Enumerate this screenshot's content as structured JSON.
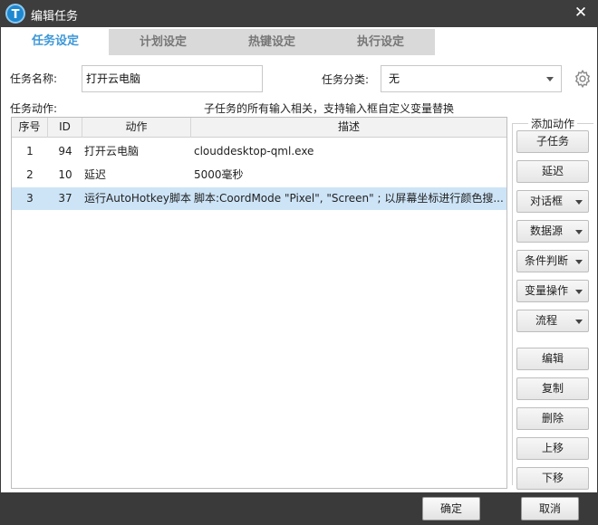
{
  "window": {
    "title": "编辑任务",
    "app_icon_letter": "T",
    "close_symbol": "✕"
  },
  "tabs": [
    {
      "label": "任务设定",
      "active": true
    },
    {
      "label": "计划设定",
      "active": false
    },
    {
      "label": "热键设定",
      "active": false
    },
    {
      "label": "执行设定",
      "active": false
    }
  ],
  "form": {
    "name_label": "任务名称:",
    "name_value": "打开云电脑",
    "category_label": "任务分类:",
    "category_value": "无",
    "actions_label": "任务动作:",
    "hint": "子任务的所有输入相关，支持输入框自定义变量替换"
  },
  "table": {
    "columns": [
      "序号",
      "ID",
      "动作",
      "描述"
    ],
    "rows": [
      {
        "seq": "1",
        "id": "94",
        "action": "打开云电脑",
        "desc": "clouddesktop-qml.exe",
        "selected": false
      },
      {
        "seq": "2",
        "id": "10",
        "action": "延迟",
        "desc": "5000毫秒",
        "selected": false
      },
      {
        "seq": "3",
        "id": "37",
        "action": "运行AutoHotkey脚本",
        "desc": "脚本:CoordMode \"Pixel\", \"Screen\" ; 以屏幕坐标进行颜色搜...",
        "selected": true
      }
    ]
  },
  "add_actions": {
    "title": "添加动作",
    "buttons": [
      {
        "label": "子任务",
        "dropdown": false
      },
      {
        "label": "延迟",
        "dropdown": false
      },
      {
        "label": "对话框",
        "dropdown": true
      },
      {
        "label": "数据源",
        "dropdown": true
      },
      {
        "label": "条件判断",
        "dropdown": true
      },
      {
        "label": "变量操作",
        "dropdown": true
      },
      {
        "label": "流程",
        "dropdown": true
      }
    ]
  },
  "edit_actions": {
    "edit": "编辑",
    "copy": "复制",
    "delete": "删除",
    "move_up": "上移",
    "move_down": "下移"
  },
  "footer": {
    "ok": "确定",
    "cancel": "取消"
  },
  "colors": {
    "accent": "#3c97d8",
    "selected_row": "#cde4f7",
    "titlebar": "#3d3d3d"
  }
}
